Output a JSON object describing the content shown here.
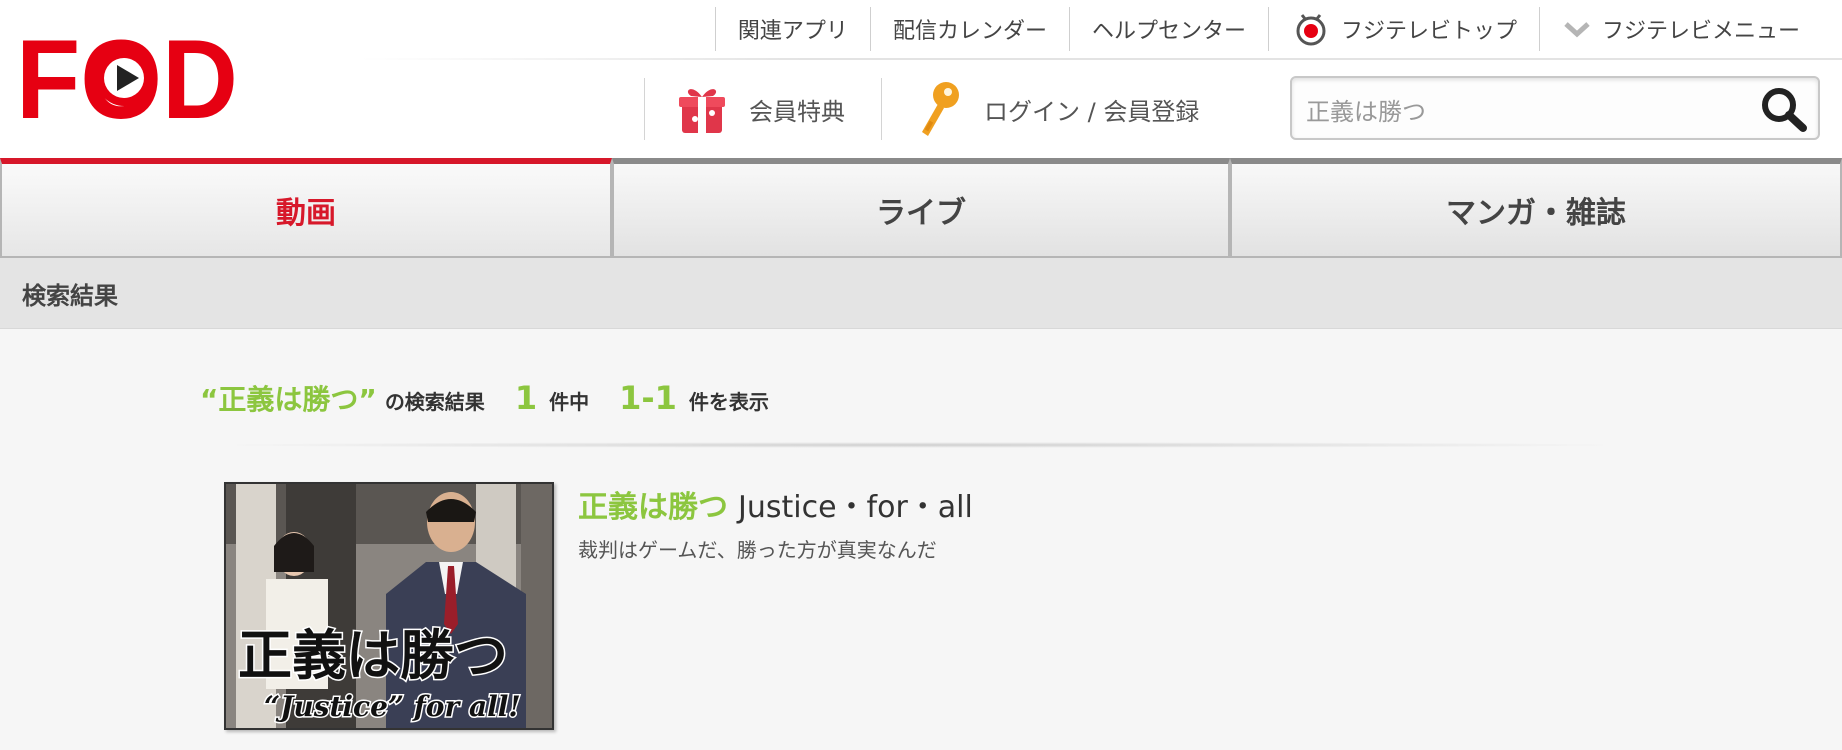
{
  "brand": {
    "logo_text": "FOD",
    "accent_color": "#e60012"
  },
  "top_nav": [
    {
      "label": "関連アプリ"
    },
    {
      "label": "配信カレンダー"
    },
    {
      "label": "ヘルプセンター"
    },
    {
      "label": "フジテレビトップ",
      "icon": "fujitv-eye-icon"
    },
    {
      "label": "フジテレビメニュー",
      "icon": "chevron-down-icon"
    }
  ],
  "secondary_nav": {
    "member_benefits": {
      "label": "会員特典",
      "icon": "gift-icon"
    },
    "login": {
      "label": "ログイン / 会員登録",
      "icon": "key-icon"
    }
  },
  "search": {
    "value": "正義は勝つ",
    "icon": "search-icon"
  },
  "tabs": [
    {
      "label": "動画",
      "active": true
    },
    {
      "label": "ライブ",
      "active": false
    },
    {
      "label": "マンガ・雑誌",
      "active": false
    }
  ],
  "page_heading": "検索結果",
  "summary": {
    "query": "“正義は勝つ”",
    "of_results_label": "の検索結果",
    "total": "1",
    "total_suffix": "件中",
    "range": "1-1",
    "range_suffix": "件を表示"
  },
  "results": [
    {
      "title_jp": "正義は勝つ",
      "title_en": "Justice・for・all",
      "description": "裁判はゲームだ、勝った方が真実なんだ",
      "thumbnail": {
        "title_text": "正義は勝つ",
        "subtitle_text": "“Justice” for all!"
      }
    }
  ],
  "colors": {
    "highlight_green": "#8cc63f",
    "active_tab_red": "#d7182a"
  }
}
